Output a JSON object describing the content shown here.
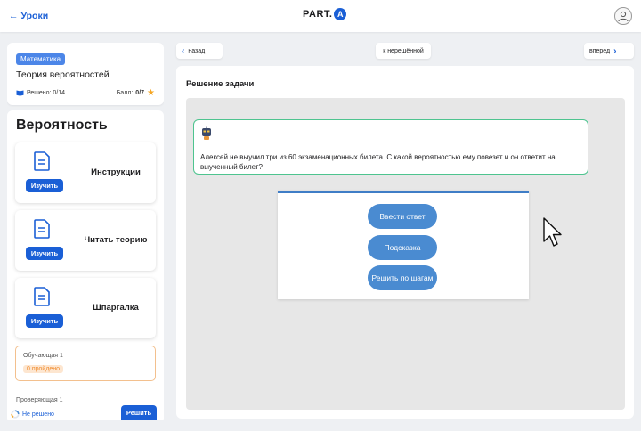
{
  "header": {
    "back_label": "Уроки",
    "logo_text": "PART.",
    "logo_badge": "A"
  },
  "sidebar": {
    "subject_tag": "Математика",
    "topic_title": "Теория вероятностей",
    "solved_label": "Решено: 0/14",
    "score_label": "Балл:",
    "score_value": "0/7",
    "section_title": "Вероятность",
    "resources": [
      {
        "label": "Инструкции",
        "button": "Изучить"
      },
      {
        "label": "Читать теорию",
        "button": "Изучить"
      },
      {
        "label": "Шпаргалка",
        "button": "Изучить"
      }
    ],
    "practice": {
      "label": "Обучающая 1",
      "progress": "0 пройдено"
    },
    "check_label": "Проверяющая 1",
    "unsolved_label": "Не решено",
    "solve_button": "Решить"
  },
  "nav": {
    "back": "назад",
    "to_unsolved": "к нерешённой",
    "forward": "вперед"
  },
  "main": {
    "title": "Решение задачи",
    "task_text": "Алексей не выучил три из 60 экзаменационных билета. С какой вероятностью ему повезет и он ответит на выученный билет?",
    "actions": [
      "Ввести ответ",
      "Подсказка",
      "Решить по шагам"
    ]
  },
  "colors": {
    "accent": "#1a5fd6",
    "pill": "#4a8bd1",
    "task_border": "#4ec48f",
    "practice_border": "#f3c08e"
  }
}
